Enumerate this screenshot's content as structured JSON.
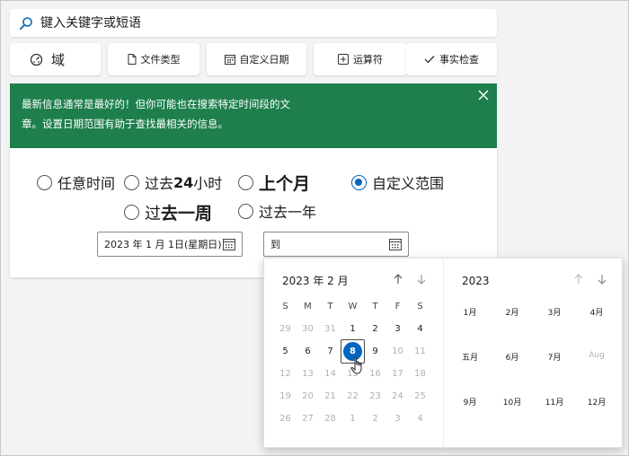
{
  "search": {
    "placeholder": "键入关键字或短语"
  },
  "filters": [
    {
      "label": "域"
    },
    {
      "label": "文件类型"
    },
    {
      "label": "自定义日期"
    },
    {
      "label": "运算符"
    },
    {
      "label": "事实检查"
    }
  ],
  "tip": {
    "text": "最新信息通常是最好的！但你可能也在搜索特定时间段的文章。设置日期范围有助于查找最相关的信息。"
  },
  "options": {
    "any_time": "任意时间",
    "past_24_prefix": "过去 ",
    "past_24_num": "24",
    "past_24_suffix": " 小时",
    "last_month": "上个月",
    "custom_range": "自定义范围",
    "past_week_prefix": "过",
    "past_week_bold": "去一周",
    "past_year": "过去一年",
    "selected": "custom_range"
  },
  "date_range": {
    "from": "2023 年 1 月 1日(星期日)",
    "to": "到"
  },
  "calendar": {
    "month_title": "2023 年 2 月",
    "weekdays": [
      "S",
      "M",
      "T",
      "W",
      "T",
      "F",
      "S"
    ],
    "weeks": [
      [
        "29",
        "30",
        "31",
        "1",
        "2",
        "3",
        "4"
      ],
      [
        "5",
        "6",
        "7",
        "8",
        "9",
        "10",
        "11"
      ],
      [
        "12",
        "13",
        "14",
        "15",
        "16",
        "17",
        "18"
      ],
      [
        "19",
        "20",
        "21",
        "22",
        "23",
        "24",
        "25"
      ],
      [
        "26",
        "27",
        "28",
        "1",
        "2",
        "3",
        "4"
      ]
    ],
    "selected_day": "8",
    "year_title": "2023",
    "months": [
      [
        "1月",
        "2月",
        "3月",
        "4月"
      ],
      [
        "五月",
        "6月",
        "7月",
        "Aug"
      ],
      [
        "9月",
        "10月",
        "11月",
        "12月"
      ]
    ]
  },
  "colors": {
    "accent": "#0067c0",
    "tip_bg": "#1e7f4d"
  }
}
